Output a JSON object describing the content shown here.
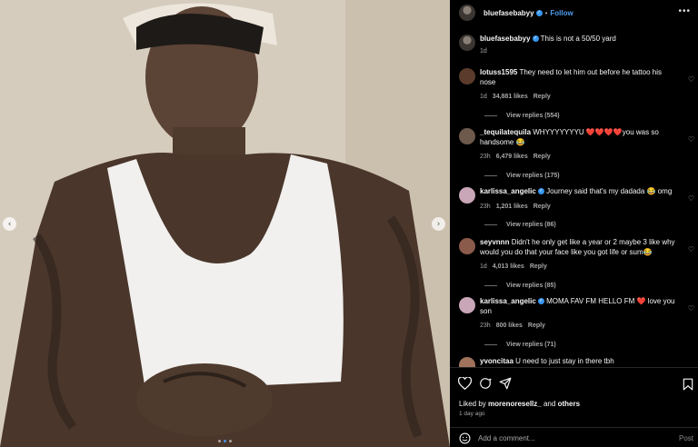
{
  "post": {
    "author": "bluefasebabyy",
    "separator": "•",
    "follow_label": "Follow",
    "more_label": "•••",
    "caption_text": "This is not a 50/50 yard",
    "caption_time": "1d",
    "carousel": {
      "slide_count": 3,
      "active_index": 1,
      "prev_label": "‹",
      "next_label": "›"
    }
  },
  "comments": [
    {
      "user": "lotuss1595",
      "verified": false,
      "text": "They need to let him out before he tattoo his nose",
      "time": "1d",
      "likes": "34,881 likes",
      "reply": "Reply",
      "replies": "View replies (554)",
      "avatar_color": "#5b3b2c"
    },
    {
      "user": "_tequilatequila",
      "verified": false,
      "text": "WHYYYYYYYU ❤️❤️❤️❤️you was so handsome 😂",
      "time": "23h",
      "likes": "6,479 likes",
      "reply": "Reply",
      "replies": "View replies (175)",
      "avatar_color": "#6d5a4c"
    },
    {
      "user": "karlissa_angelic",
      "verified": true,
      "text": "Journey said that's my dadada 😂 omg",
      "time": "23h",
      "likes": "1,201 likes",
      "reply": "Reply",
      "replies": "View replies (86)",
      "avatar_color": "#c9a6b8"
    },
    {
      "user": "seyvnnn",
      "verified": false,
      "text": "Didn't he only get like a year or 2 maybe 3 like why would you do that your face like you got life or sum😂",
      "time": "1d",
      "likes": "4,013 likes",
      "reply": "Reply",
      "replies": "View replies (85)",
      "avatar_color": "#8a5a4a"
    },
    {
      "user": "karlissa_angelic",
      "verified": true,
      "text": "MOMA FAV FM HELLO FM ❤️ love you son",
      "time": "23h",
      "likes": "800 likes",
      "reply": "Reply",
      "replies": "View replies (71)",
      "avatar_color": "#c9a6b8"
    },
    {
      "user": "yvoncitaa",
      "verified": false,
      "text": "U need to just stay in there tbh",
      "time": "",
      "likes": "",
      "reply": "",
      "replies": "",
      "avatar_color": "#a0725c"
    }
  ],
  "footer": {
    "liked_by_prefix": "Liked by",
    "liked_by_user": "morenoresellz_",
    "liked_by_and": "and",
    "liked_by_others": "others",
    "time_ago": "1 day ago",
    "comment_placeholder": "Add a comment...",
    "post_label": "Post"
  },
  "icons": [
    "heart-icon",
    "comment-icon",
    "share-icon",
    "bookmark-icon",
    "emoji-icon",
    "more-icon",
    "verified-icon"
  ],
  "colors": {
    "background": "#000000",
    "follow": "#4c9cf0",
    "muted": "#a8a8a8",
    "verified": "#3897f0"
  }
}
